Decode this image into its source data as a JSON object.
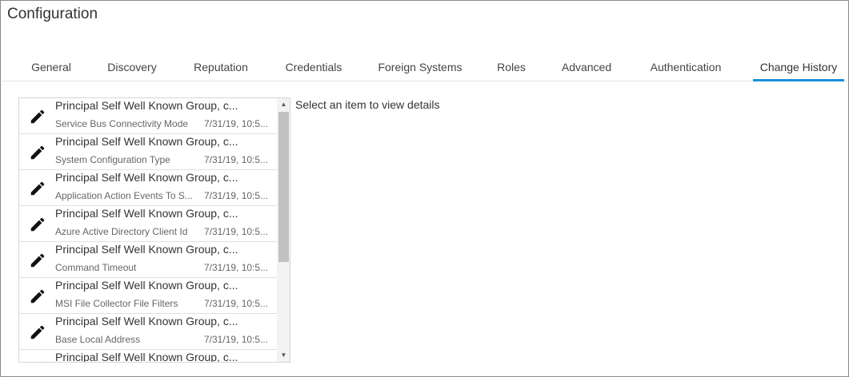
{
  "page": {
    "title": "Configuration"
  },
  "tabs": [
    {
      "label": "General",
      "active": false
    },
    {
      "label": "Discovery",
      "active": false
    },
    {
      "label": "Reputation",
      "active": false
    },
    {
      "label": "Credentials",
      "active": false
    },
    {
      "label": "Foreign Systems",
      "active": false
    },
    {
      "label": "Roles",
      "active": false
    },
    {
      "label": "Advanced",
      "active": false
    },
    {
      "label": "Authentication",
      "active": false
    },
    {
      "label": "Change History",
      "active": true
    }
  ],
  "accent_color": "#1b8fd6",
  "history": {
    "items": [
      {
        "icon": "pencil-icon",
        "title": "Principal Self Well Known Group, c...",
        "setting": "Service Bus Connectivity Mode",
        "date": "7/31/19, 10:5..."
      },
      {
        "icon": "pencil-icon",
        "title": "Principal Self Well Known Group, c...",
        "setting": "System Configuration Type",
        "date": "7/31/19, 10:5..."
      },
      {
        "icon": "pencil-icon",
        "title": "Principal Self Well Known Group, c...",
        "setting": "Application Action Events To S...",
        "date": "7/31/19, 10:5..."
      },
      {
        "icon": "pencil-icon",
        "title": "Principal Self Well Known Group, c...",
        "setting": "Azure Active Directory Client Id",
        "date": "7/31/19, 10:5..."
      },
      {
        "icon": "pencil-icon",
        "title": "Principal Self Well Known Group, c...",
        "setting": "Command Timeout",
        "date": "7/31/19, 10:5..."
      },
      {
        "icon": "pencil-icon",
        "title": "Principal Self Well Known Group, c...",
        "setting": "MSI File Collector File Filters",
        "date": "7/31/19, 10:5..."
      },
      {
        "icon": "pencil-icon",
        "title": "Principal Self Well Known Group, c...",
        "setting": "Base Local Address",
        "date": "7/31/19, 10:5..."
      },
      {
        "icon": "pencil-icon",
        "title": "Principal Self Well Known Group, c...",
        "setting": "",
        "date": ""
      }
    ]
  },
  "details": {
    "placeholder": "Select an item to view details"
  }
}
